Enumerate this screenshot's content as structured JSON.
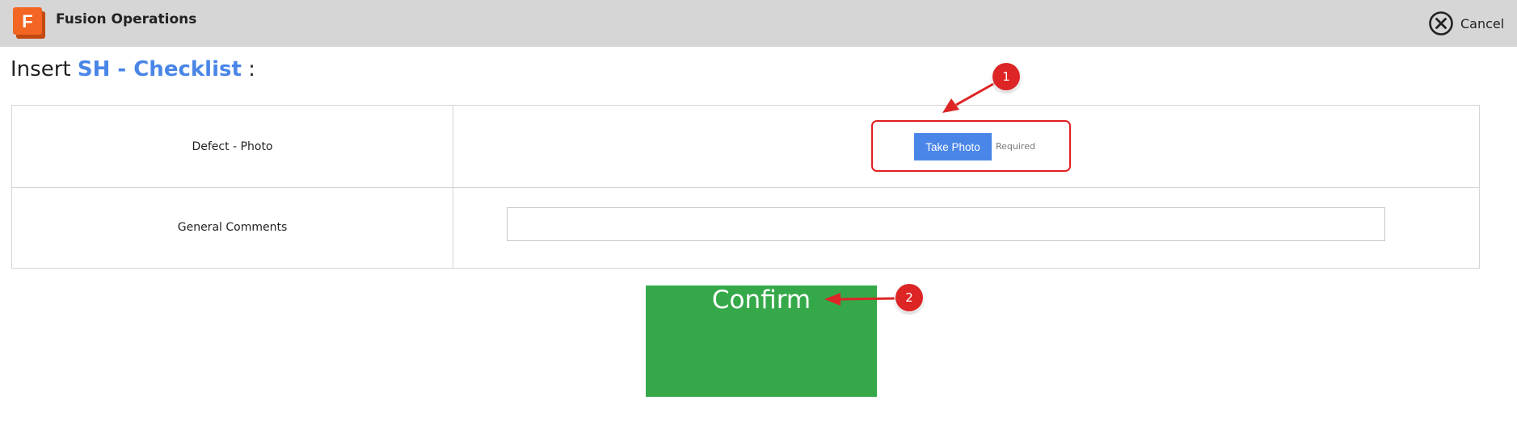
{
  "header": {
    "app_title": "Fusion Operations",
    "logo_letter": "F",
    "cancel_label": "Cancel",
    "brand_color": "#f26522",
    "bar_color": "#d6d6d6"
  },
  "page": {
    "heading_prefix": "Insert ",
    "form_name": "SH - Checklist",
    "heading_suffix": " :"
  },
  "form": {
    "rows": [
      {
        "label": "Defect - Photo",
        "button_label": "Take Photo",
        "status": "Required"
      },
      {
        "label": "General Comments",
        "value": "",
        "placeholder": ""
      }
    ]
  },
  "confirm": {
    "label": "Confirm",
    "color": "#35a94a"
  },
  "annotations": {
    "badges": [
      "1",
      "2"
    ],
    "color": "#dd2525"
  },
  "icons": {
    "logo": "fusion-operations-logo-icon",
    "cancel": "circle-x-icon"
  }
}
